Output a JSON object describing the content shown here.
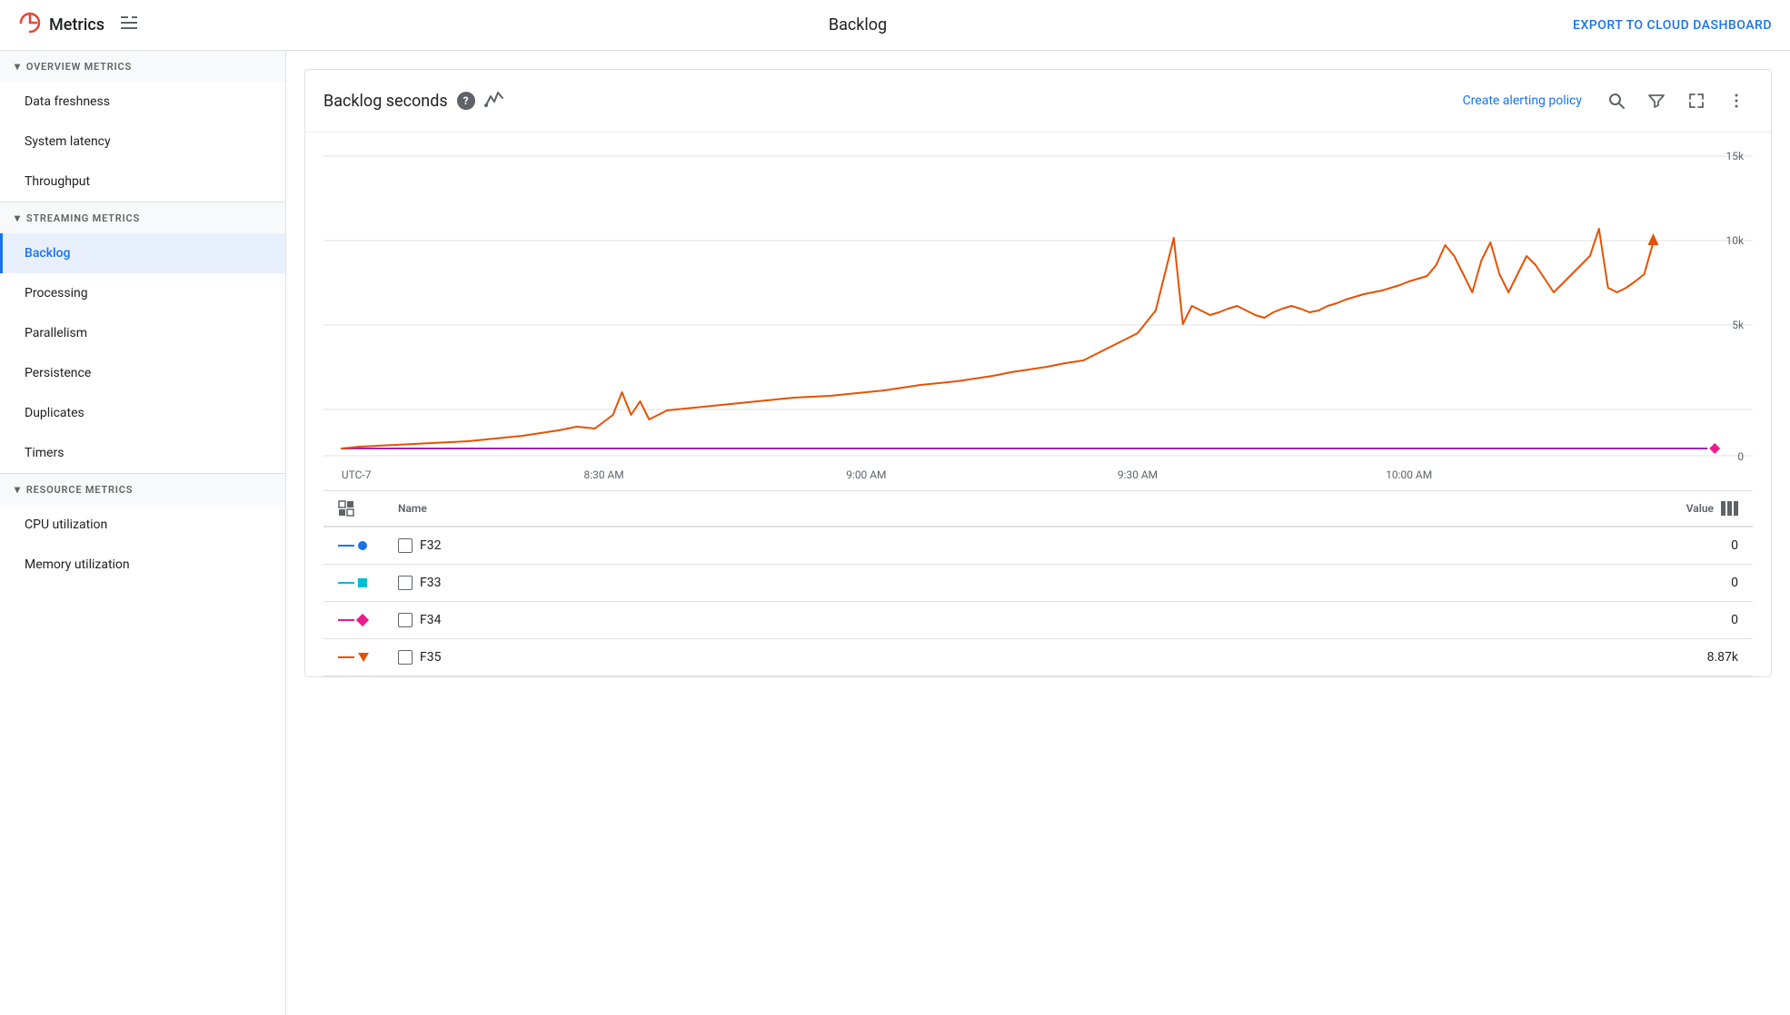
{
  "app": {
    "logo_text": "Metrics",
    "logo_icon": "📊",
    "page_title": "Backlog",
    "export_label": "EXPORT TO CLOUD DASHBOARD"
  },
  "sidebar": {
    "sections": [
      {
        "id": "overview",
        "label": "OVERVIEW METRICS",
        "expanded": true,
        "items": [
          {
            "id": "data-freshness",
            "label": "Data freshness",
            "active": false
          },
          {
            "id": "system-latency",
            "label": "System latency",
            "active": false
          },
          {
            "id": "throughput",
            "label": "Throughput",
            "active": false
          }
        ]
      },
      {
        "id": "streaming",
        "label": "STREAMING METRICS",
        "expanded": true,
        "items": [
          {
            "id": "backlog",
            "label": "Backlog",
            "active": true
          },
          {
            "id": "processing",
            "label": "Processing",
            "active": false
          },
          {
            "id": "parallelism",
            "label": "Parallelism",
            "active": false
          },
          {
            "id": "persistence",
            "label": "Persistence",
            "active": false
          },
          {
            "id": "duplicates",
            "label": "Duplicates",
            "active": false
          },
          {
            "id": "timers",
            "label": "Timers",
            "active": false
          }
        ]
      },
      {
        "id": "resource",
        "label": "RESOURCE METRICS",
        "expanded": true,
        "items": [
          {
            "id": "cpu-utilization",
            "label": "CPU utilization",
            "active": false
          },
          {
            "id": "memory-utilization",
            "label": "Memory utilization",
            "active": false
          }
        ]
      }
    ]
  },
  "chart": {
    "title": "Backlog seconds",
    "create_alert_label": "Create alerting policy",
    "y_labels": [
      "15k",
      "10k",
      "5k",
      "0"
    ],
    "x_labels": [
      "UTC-7",
      "8:30 AM",
      "9:00 AM",
      "9:30 AM",
      "10:00 AM",
      ""
    ],
    "legend": {
      "name_col": "Name",
      "value_col": "Value",
      "rows": [
        {
          "id": "F32",
          "name": "F32",
          "color_line": "#1a73e8",
          "marker": "dot",
          "marker_color": "#1a73e8",
          "value": "0"
        },
        {
          "id": "F33",
          "name": "F33",
          "color_line": "#00bcd4",
          "marker": "square",
          "marker_color": "#00bcd4",
          "value": "0"
        },
        {
          "id": "F34",
          "name": "F34",
          "color_line": "#e91e8c",
          "marker": "diamond",
          "marker_color": "#e91e8c",
          "value": "0"
        },
        {
          "id": "F35",
          "name": "F35",
          "color_line": "#e65100",
          "marker": "triangle",
          "marker_color": "#e65100",
          "value": "8.87k"
        }
      ]
    }
  },
  "colors": {
    "orange_line": "#e65100",
    "purple_line": "#9c27b0",
    "blue": "#1a73e8",
    "accent": "#e91e8c"
  }
}
